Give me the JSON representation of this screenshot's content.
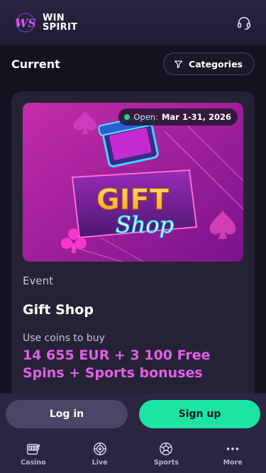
{
  "header": {
    "brand_line1": "WIN",
    "brand_line2": "SPIRIT",
    "logo_icon": "ws-logo-icon",
    "support_icon": "headset-icon"
  },
  "section": {
    "title": "Current",
    "categories_label": "Categories",
    "filter_icon": "filter-icon"
  },
  "event_card": {
    "banner": {
      "open_label": "Open:",
      "open_dates": "Mar 1-31, 2026",
      "banner_word1": "GIFT",
      "banner_word2": "Shop"
    },
    "type": "Event",
    "title": "Gift Shop",
    "coins_label": "Use coins to buy",
    "prize": "14 655 EUR + 3 100 Free Spins + Sports bonuses"
  },
  "auth": {
    "login_label": "Log in",
    "signup_label": "Sign up"
  },
  "bottom_nav": [
    {
      "label": "Casino",
      "icon": "slot-machine-icon"
    },
    {
      "label": "Live",
      "icon": "roulette-icon"
    },
    {
      "label": "Sports",
      "icon": "soccer-ball-icon"
    },
    {
      "label": "More",
      "icon": "more-dots-icon"
    }
  ],
  "colors": {
    "background": "#15121f",
    "card": "#262236",
    "accent_pink": "#e160e6",
    "signup_green": "#1de4a2",
    "status_green": "#1fd48a"
  }
}
